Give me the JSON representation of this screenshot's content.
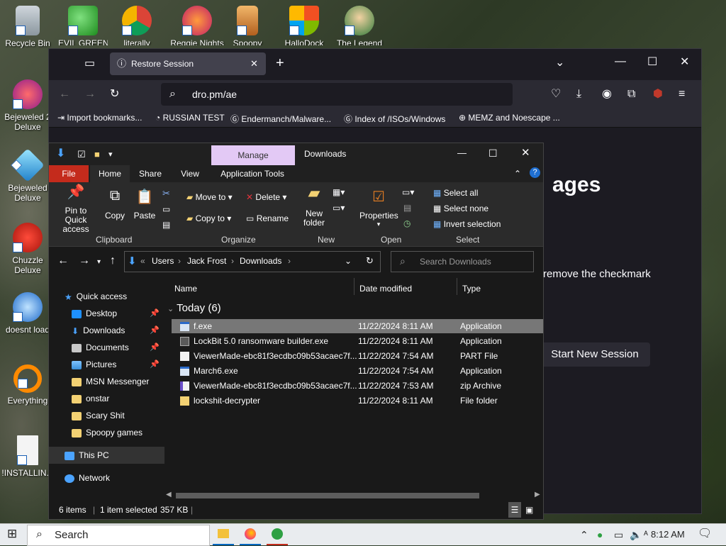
{
  "desktop": {
    "icons": [
      {
        "label": "Recycle Bin"
      },
      {
        "label": "EVIL GREEN"
      },
      {
        "label": "literally"
      },
      {
        "label": "Reggie Nights"
      },
      {
        "label": "Spoopy"
      },
      {
        "label": "HalloDock"
      },
      {
        "label": "The Legend"
      },
      {
        "label": "Bejeweled 2 Deluxe"
      },
      {
        "label": "Bejeweled Deluxe"
      },
      {
        "label": "Chuzzle Deluxe"
      },
      {
        "label": "doesnt load"
      },
      {
        "label": "Everything"
      },
      {
        "label": "!INSTALLIN..."
      }
    ]
  },
  "firefox": {
    "tab_title": "Restore Session",
    "url": "dro.pm/ae",
    "bookmarks": [
      "Import bookmarks...",
      "RUSSIAN TEST",
      "Endermanch/Malware...",
      "Index of /ISOs/Windows",
      "MEMZ and Noescape ..."
    ],
    "content": {
      "heading_fragment": "ages",
      "text_fragment": "remove the checkmark",
      "button_label": "Start New Session"
    }
  },
  "explorer": {
    "title": "Downloads",
    "manage_label": "Manage",
    "tabs": [
      "File",
      "Home",
      "Share",
      "View",
      "Application Tools"
    ],
    "ribbon": {
      "pin": "Pin to Quick access",
      "copy": "Copy",
      "paste": "Paste",
      "move_to": "Move to",
      "copy_to": "Copy to",
      "delete": "Delete",
      "rename": "Rename",
      "new_folder": "New folder",
      "properties": "Properties",
      "select_all": "Select all",
      "select_none": "Select none",
      "invert_selection": "Invert selection",
      "groups": [
        "Clipboard",
        "Organize",
        "New",
        "Open",
        "Select"
      ]
    },
    "breadcrumb": [
      "Users",
      "Jack Frost",
      "Downloads"
    ],
    "breadcrumb_prefix": "«",
    "search_placeholder": "Search Downloads",
    "nav": [
      {
        "label": "Quick access",
        "pinned": false
      },
      {
        "label": "Desktop",
        "pinned": true
      },
      {
        "label": "Downloads",
        "pinned": true
      },
      {
        "label": "Documents",
        "pinned": true
      },
      {
        "label": "Pictures",
        "pinned": true
      },
      {
        "label": "MSN Messenger",
        "pinned": false
      },
      {
        "label": "onstar",
        "pinned": false
      },
      {
        "label": "Scary Shit",
        "pinned": false
      },
      {
        "label": "Spoopy games",
        "pinned": false
      },
      {
        "label": "This PC",
        "pinned": false
      },
      {
        "label": "Network",
        "pinned": false
      }
    ],
    "columns": [
      "Name",
      "Date modified",
      "Type"
    ],
    "group_label": "Today (6)",
    "files": [
      {
        "name": "f.exe",
        "date": "11/22/2024 8:11 AM",
        "type": "Application",
        "selected": true
      },
      {
        "name": "LockBit 5.0 ransomware builder.exe",
        "date": "11/22/2024 8:11 AM",
        "type": "Application",
        "selected": false
      },
      {
        "name": "ViewerMade-ebc81f3ecdbc09b53acaec7f...",
        "date": "11/22/2024 7:54 AM",
        "type": "PART File",
        "selected": false
      },
      {
        "name": "March6.exe",
        "date": "11/22/2024 7:54 AM",
        "type": "Application",
        "selected": false
      },
      {
        "name": "ViewerMade-ebc81f3ecdbc09b53acaec7f...",
        "date": "11/22/2024 7:53 AM",
        "type": "zip Archive",
        "selected": false
      },
      {
        "name": "lockshit-decrypter",
        "date": "11/22/2024 8:11 AM",
        "type": "File folder",
        "selected": false
      }
    ],
    "status": {
      "items": "6 items",
      "selected": "1 item selected",
      "size": "357 KB"
    }
  },
  "taskbar": {
    "search_label": "Search",
    "clock": "8:12 AM"
  }
}
